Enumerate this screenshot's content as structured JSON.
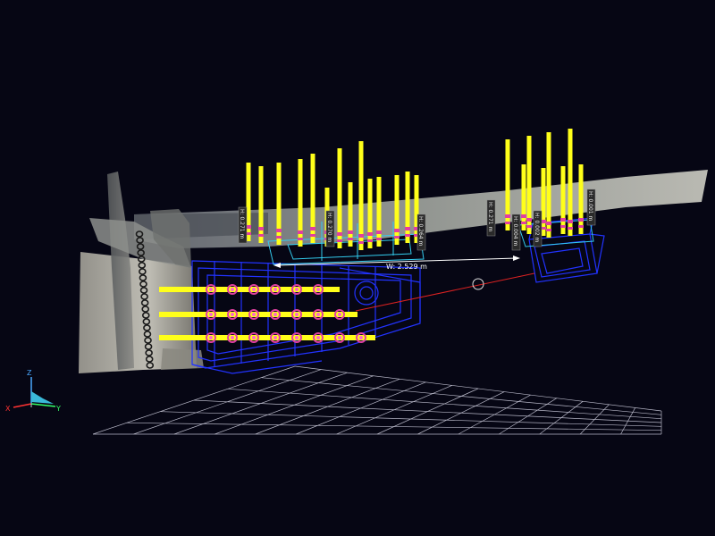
{
  "viewer": {
    "background_color": "#060614",
    "floor_grid_color": "#b8b8c8",
    "pipe_color": "#ffff1a",
    "pipe_band_color": "#e040a0",
    "box_outline_color": "#2233ff",
    "cyan_outline_color": "#33ccee",
    "measure_line_color": "#ffffff",
    "ray_color": "#dd2222"
  },
  "measurement": {
    "width_label": "W: 2.529 m"
  },
  "height_labels": [
    "H: 0.271 m",
    "H: 0.270 m",
    "H: 0.264 m",
    "H: 0.271 m",
    "H: 0.004 m",
    "H: 0.002 m",
    "H: 0.001 m"
  ],
  "axis_triad": {
    "z": "Z",
    "x": "X",
    "y": "Y",
    "z_color": "#4aa8ff",
    "x_color": "#ff3333",
    "y_color": "#33ff66"
  },
  "icons": {
    "cursor": "crosshair-circle-icon"
  }
}
